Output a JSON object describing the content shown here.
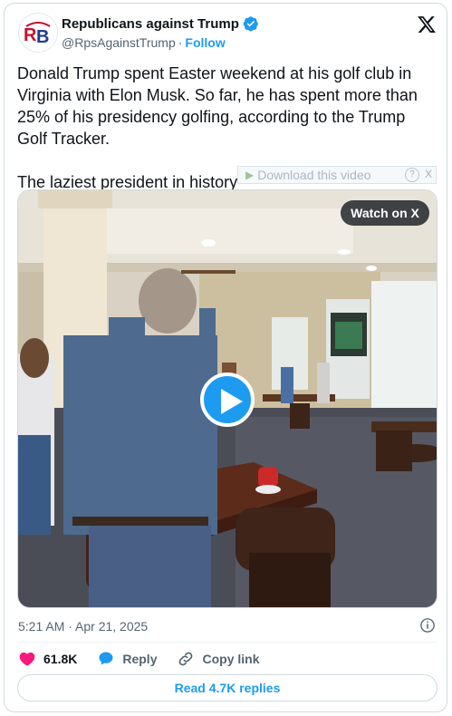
{
  "author": {
    "display_name": "Republicans against Trump",
    "handle": "@RpsAgainstTrump",
    "separator": "·",
    "follow_label": "Follow",
    "avatar_initials": "RB"
  },
  "tweet": {
    "text_paragraph_1": "Donald Trump spent Easter weekend at his golf club in Virginia with Elon Musk. So far, he has spent more than 25% of his presidency golfing, according to the Trump Golf Tracker.",
    "text_paragraph_2": "The laziest president in history"
  },
  "download_overlay": {
    "label": "Download this video",
    "help": "?",
    "close": "X"
  },
  "media": {
    "watch_label": "Watch on X"
  },
  "meta": {
    "timestamp": "5:21 AM · Apr 21, 2025"
  },
  "actions": {
    "like_count": "61.8K",
    "reply_label": "Reply",
    "copy_label": "Copy link"
  },
  "read_replies_label": "Read 4.7K replies",
  "colors": {
    "accent": "#1d9bf0",
    "like": "#f91880",
    "text": "#0f1419",
    "muted": "#536471"
  }
}
